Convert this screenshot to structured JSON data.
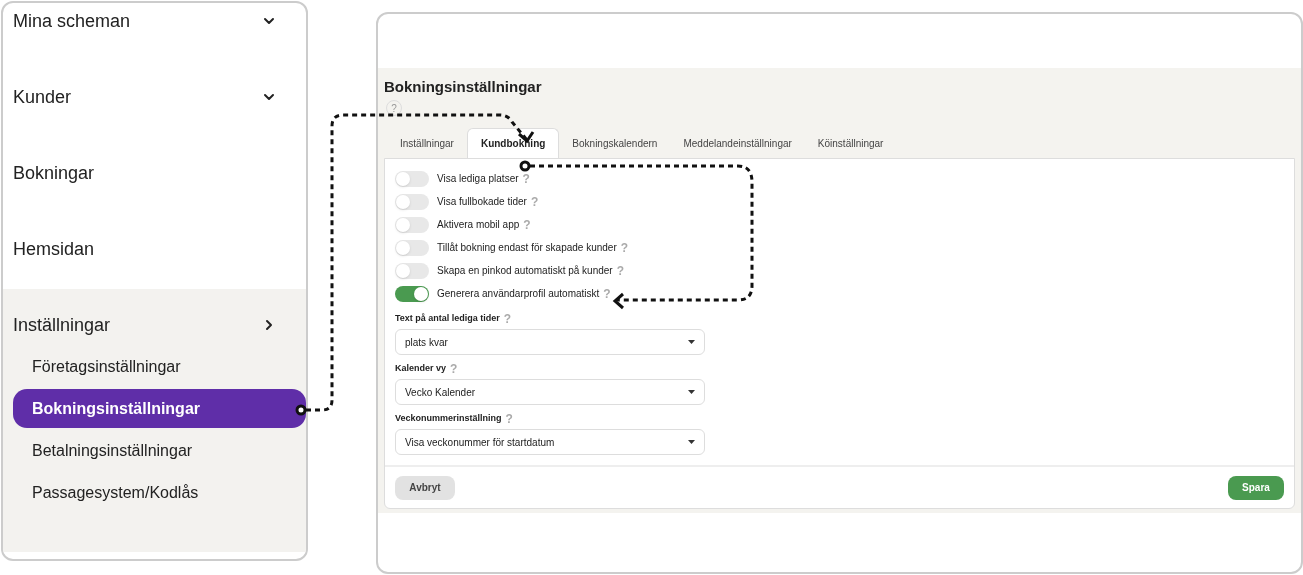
{
  "sidebar": {
    "items": [
      {
        "label": "Mina scheman",
        "kind": "dropdown"
      },
      {
        "label": "Kunder",
        "kind": "dropdown"
      },
      {
        "label": "Bokningar",
        "kind": "link"
      },
      {
        "label": "Hemsidan",
        "kind": "link"
      },
      {
        "label": "Inställningar",
        "kind": "submenu",
        "children": [
          {
            "label": "Företagsinställningar",
            "selected": false
          },
          {
            "label": "Bokningsinställningar",
            "selected": true
          },
          {
            "label": "Betalningsinställningar",
            "selected": false
          },
          {
            "label": "Passagesystem/Kodlås",
            "selected": false
          }
        ]
      }
    ]
  },
  "settings": {
    "title": "Bokningsinställningar",
    "title_help": "?",
    "tabs": [
      {
        "label": "Inställningar",
        "selected": false
      },
      {
        "label": "Kundbokning",
        "selected": true
      },
      {
        "label": "Bokningskalendern",
        "selected": false
      },
      {
        "label": "Meddelandeinställningar",
        "selected": false
      },
      {
        "label": "Köinställningar",
        "selected": false
      }
    ],
    "toggles": [
      {
        "label": "Visa lediga platser",
        "help": "?",
        "on": false
      },
      {
        "label": "Visa fullbokade tider",
        "help": "?",
        "on": false
      },
      {
        "label": "Aktivera mobil app",
        "help": "?",
        "on": false
      },
      {
        "label": "Tillåt bokning endast för skapade kunder",
        "help": "?",
        "on": false
      },
      {
        "label": "Skapa en pinkod automatiskt på kunder",
        "help": "?",
        "on": false
      },
      {
        "label": "Generera användarprofil automatiskt",
        "help": "?",
        "on": true
      }
    ],
    "dropdowns": [
      {
        "label": "Text på antal lediga tider",
        "help": "?",
        "value": "plats kvar"
      },
      {
        "label": "Kalender vy",
        "help": "?",
        "value": "Vecko Kalender"
      },
      {
        "label": "Veckonummerinställning",
        "help": "?",
        "value": "Visa veckonummer för startdatum"
      }
    ],
    "cancel": "Avbryt",
    "save": "Spara"
  }
}
